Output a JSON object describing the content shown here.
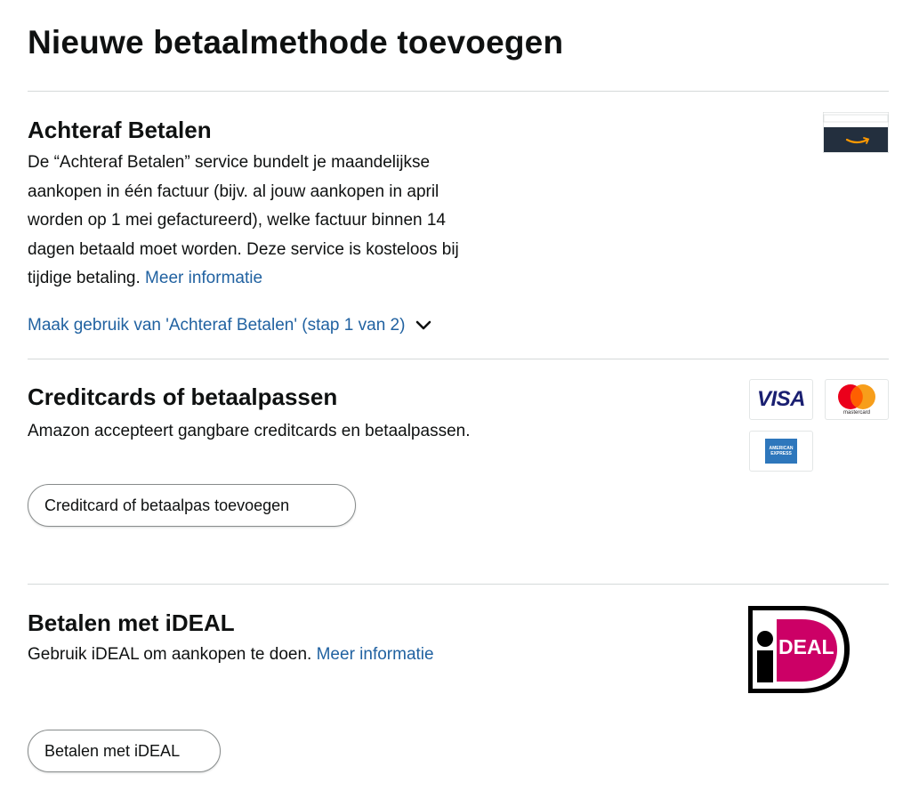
{
  "page": {
    "title": "Nieuwe betaalmethode toevoegen"
  },
  "achteraf": {
    "title": "Achteraf Betalen",
    "description_lines": [
      "De “Achteraf Betalen” service bundelt je maandelijkse",
      "aankopen in één factuur (bijv. al jouw aankopen in april",
      "worden op 1 mei gefactureerd), welke factuur binnen 14",
      "dagen betaald moet worden. Deze service is kosteloos bij",
      "tijdige betaling."
    ],
    "more_info_link": "Meer informatie",
    "expander_label": "Maak gebruik van 'Achteraf Betalen' (stap 1 van 2)",
    "logo_icon": "amazon-card-icon"
  },
  "creditcards": {
    "title": "Creditcards of betaalpassen",
    "description": "Amazon accepteert gangbare creditcards en betaalpassen.",
    "button_label": "Creditcard of betaalpas toevoegen",
    "logos": {
      "visa_text": "VISA",
      "mastercard_text": "mastercard",
      "amex_text_top": "AMERICAN",
      "amex_text_bottom": "EXPRESS"
    },
    "colors": {
      "visa_blue": "#1a1f71",
      "mastercard_red": "#eb001b",
      "mastercard_orange": "#f79e1b",
      "amex_blue": "#2e77bc"
    }
  },
  "ideal": {
    "title": "Betalen met iDEAL",
    "description": "Gebruik iDEAL om aankopen te doen.",
    "more_info_link": "Meer informatie",
    "button_label": "Betalen met iDEAL",
    "logo_text": "DEAL",
    "colors": {
      "ideal_pink": "#cc0066"
    }
  },
  "colors": {
    "link": "#2162a1",
    "text": "#0f1111",
    "divider": "#d5d9d9"
  }
}
